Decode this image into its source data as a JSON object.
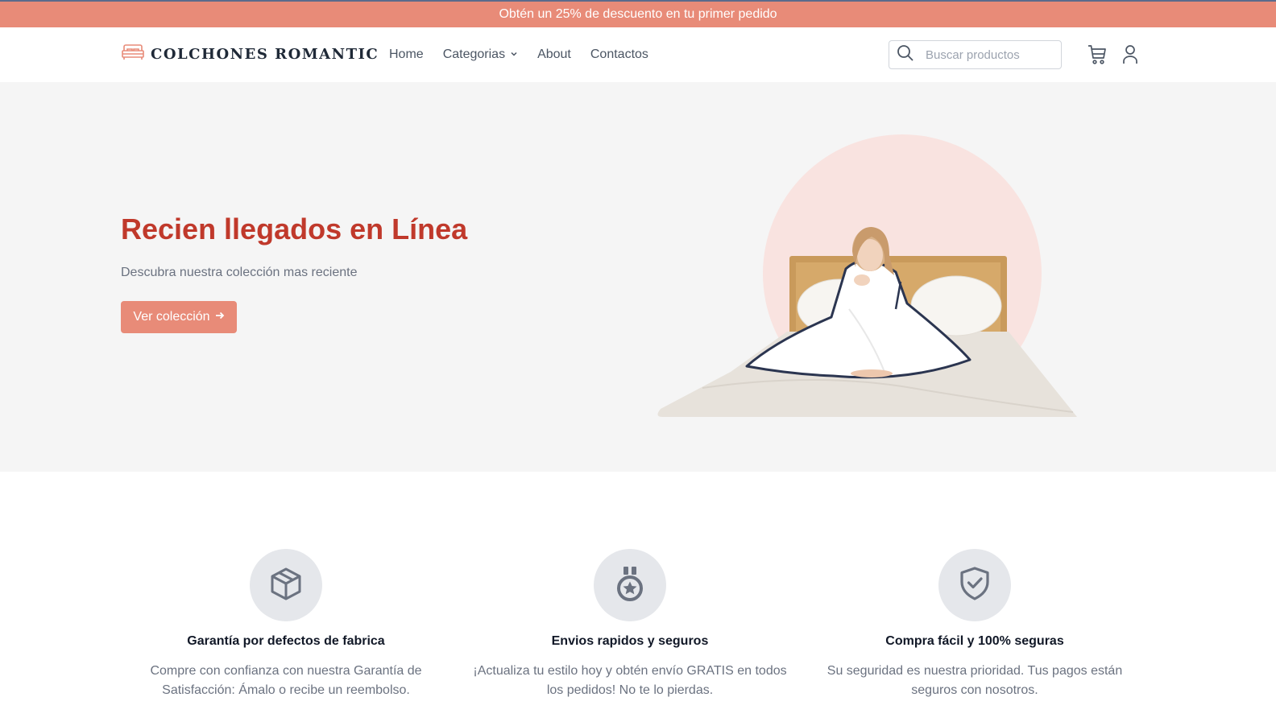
{
  "promo": {
    "text": "Obtén un 25% de descuento en tu primer pedido"
  },
  "header": {
    "logo_text": "COLCHONES ROMANTIC",
    "nav": [
      {
        "label": "Home"
      },
      {
        "label": "Categorias",
        "has_dropdown": true
      },
      {
        "label": "About"
      },
      {
        "label": "Contactos"
      }
    ],
    "search": {
      "placeholder": "Buscar productos",
      "value": ""
    },
    "icons": [
      "search-icon",
      "cart-icon",
      "user-icon"
    ]
  },
  "hero": {
    "title": "Recien llegados en Línea",
    "subtitle": "Descubra nuestra colección mas reciente",
    "cta_label": "Ver colección"
  },
  "features": [
    {
      "icon": "box-icon",
      "title": "Garantía por defectos de fabrica",
      "description": "Compre con confianza con nuestra Garantía de Satisfacción: Ámalo o recibe un reembolso."
    },
    {
      "icon": "medal-icon",
      "title": "Envios rapidos y seguros",
      "description": "¡Actualiza tu estilo hoy y obtén envío GRATIS en todos los pedidos! No te lo pierdas."
    },
    {
      "icon": "shield-check-icon",
      "title": "Compra fácil y 100% seguras",
      "description": "Su seguridad es nuestra prioridad. Tus pagos están seguros con nosotros."
    }
  ],
  "colors": {
    "accent": "#e88b78",
    "headline": "#c0392b",
    "hero_bg": "#f5f5f5",
    "circle": "#f9e3e0",
    "icon_circle": "#e5e7eb"
  }
}
